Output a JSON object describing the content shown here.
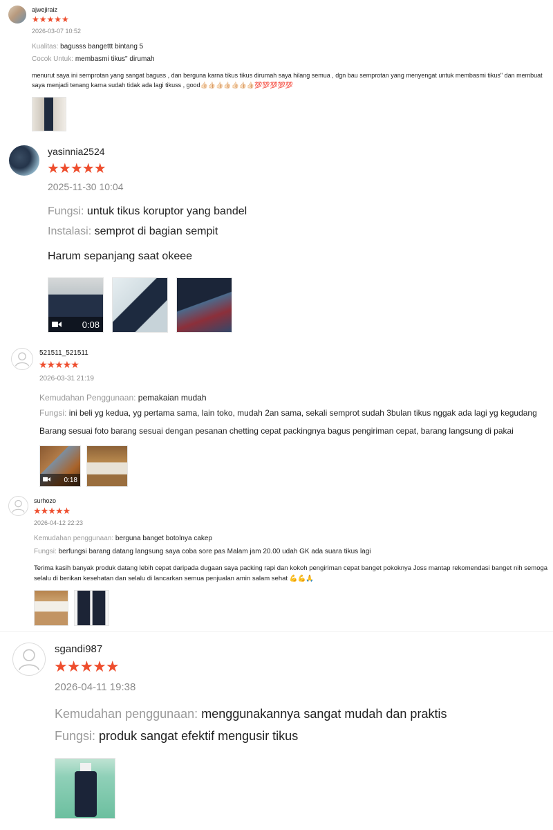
{
  "reviews": [
    {
      "username": "ajwejiraiz",
      "stars": "★★★★★",
      "date": "2026-03-07 10:52",
      "attrs": [
        {
          "label": "Kualitas:",
          "value": "bagusss bangettt bintang 5"
        },
        {
          "label": "Cocok Untuk:",
          "value": "membasmi tikus\" dirumah"
        }
      ],
      "text": "menurut saya ini semprotan yang sangat baguss , dan berguna karna tikus tikus dirumah saya hilang semua , dgn bau semprotan yang menyengat untuk membasmi tikus\" dan membuat saya menjadi tenang karna sudah tidak ada lagi tikuss , good👍🏻👍🏻👍🏻👍🏻👍🏻👍🏻👍🏻💯💯💯💯💯"
    },
    {
      "username": "yasinnia2524",
      "stars": "★★★★★",
      "date": "2025-11-30 10:04",
      "attrs": [
        {
          "label": "Fungsi:",
          "value": "untuk tikus koruptor yang bandel"
        },
        {
          "label": "Instalasi:",
          "value": "semprot di bagian sempit"
        }
      ],
      "text": "Harum sepanjang saat okeee",
      "video_duration": "0:08"
    },
    {
      "username": "521511_521511",
      "stars": "★★★★★",
      "date": "2026-03-31 21:19",
      "attrs": [
        {
          "label": "Kemudahan Penggunaan:",
          "value": "pemakaian mudah"
        },
        {
          "label": "Fungsi:",
          "value": "ini beli yg kedua, yg pertama sama, lain toko, mudah 2an sama, sekali semprot sudah 3bulan tikus nggak ada lagi yg kegudang"
        }
      ],
      "text": "Barang sesuai foto barang sesuai dengan pesanan chetting cepat packingnya bagus pengiriman cepat, barang langsung di pakai",
      "video_duration": "0:18"
    },
    {
      "username": "surhozo",
      "stars": "★★★★★",
      "date": "2026-04-12 22:23",
      "attrs": [
        {
          "label": "Kemudahan penggunaan:",
          "value": "berguna banget botolnya cakep"
        },
        {
          "label": "Fungsi:",
          "value": "berfungsi barang datang langsung saya coba sore pas Malam jam 20.00 udah GK ada suara tikus lagi"
        }
      ],
      "text": "Terima kasih banyak produk datang lebih cepat daripada dugaan saya packing rapi dan kokoh pengiriman cepat banget pokoknya Joss mantap rekomendasi banget nih semoga selalu di berikan kesehatan dan selalu di lancarkan semua penjualan amin salam sehat 💪💪🙏"
    },
    {
      "username": "sgandi987",
      "stars": "★★★★★",
      "date": "2026-04-11 19:38",
      "attrs": [
        {
          "label": "Kemudahan penggunaan:",
          "value": "menggunakannya sangat mudah dan praktis"
        },
        {
          "label": "Fungsi:",
          "value": "produk sangat efektif mengusir tikus"
        }
      ]
    }
  ],
  "colors": {
    "star": "#ee4d2d",
    "label": "#9a9a9a",
    "date": "#8a8a8a"
  },
  "icons": {
    "video": "video-camera-icon",
    "default_avatar": "user-silhouette-icon"
  }
}
